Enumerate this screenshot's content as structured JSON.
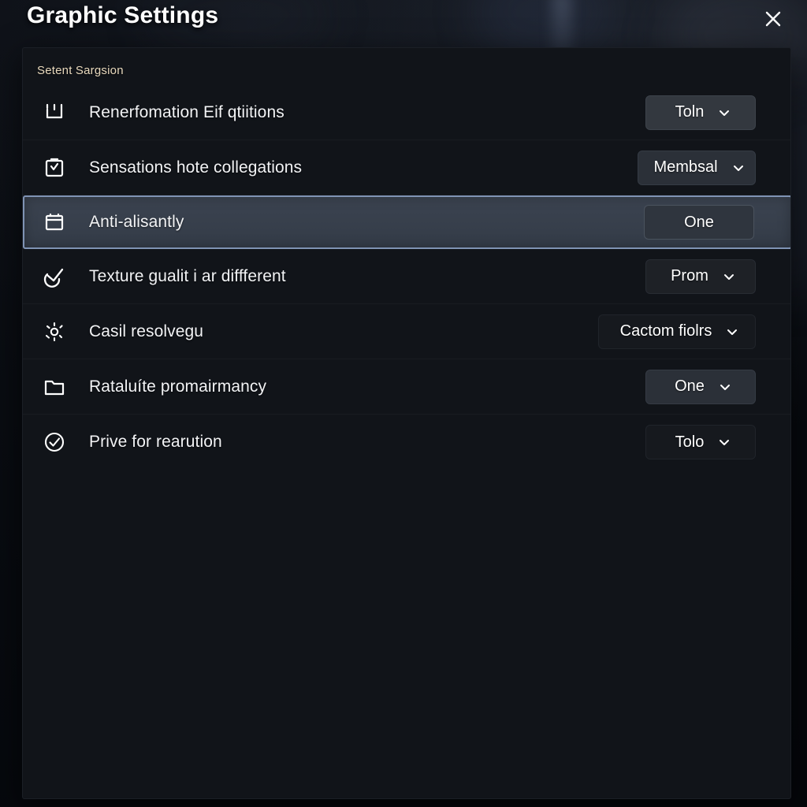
{
  "window": {
    "title": "Graphic Settings",
    "close_icon": "close-icon"
  },
  "panel": {
    "section_header": "Setent Sargsion",
    "rows": [
      {
        "icon": "tray-bracket-icon",
        "label": "Renerfomation Eif qtiitions",
        "control": {
          "type": "dropdown",
          "value": "Toln",
          "chevron": "chevron-down-icon"
        }
      },
      {
        "icon": "clipboard-check-icon",
        "label": "Sensations hote collegations",
        "control": {
          "type": "dropdown",
          "value": "Membsal",
          "chevron": "chevron-down-icon"
        }
      },
      {
        "icon": "calendar-icon",
        "label": "Anti-alisantly",
        "selected": true,
        "control": {
          "type": "dropdown",
          "value": "One",
          "chevron": ""
        }
      },
      {
        "icon": "check-swoosh-icon",
        "label": "Texture gualit i ar diffferent",
        "control": {
          "type": "dropdown",
          "value": "Prom",
          "chevron": "chevron-down-icon"
        }
      },
      {
        "icon": "brightness-icon",
        "label": "Casil resolvegu",
        "control": {
          "type": "dropdown",
          "value": "Cactom fiolrs",
          "chevron": "chevron-down-icon"
        }
      },
      {
        "icon": "folder-icon",
        "label": "Rataluíte promairmancy",
        "control": {
          "type": "dropdown",
          "value": "One",
          "chevron": "chevron-down-icon"
        }
      },
      {
        "icon": "check-circle-icon",
        "label": "Prive for rearution",
        "control": {
          "type": "dropdown",
          "value": "Tolo",
          "chevron": "chevron-down-icon"
        }
      }
    ]
  },
  "colors": {
    "panel_bg": "#111419",
    "page_bg": "#07090e",
    "selected_border": "#7f93b4",
    "selected_fill": "#3b4350",
    "section_header_text": "#e8d9bd",
    "label_text": "#f2f3f5"
  }
}
